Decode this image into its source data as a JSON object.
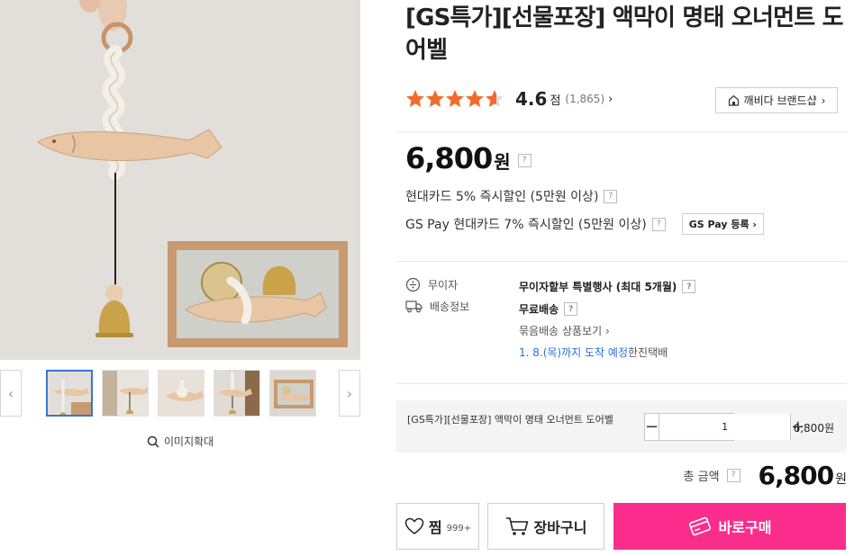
{
  "product": {
    "title": "[GS특가][선물포장] 액막이 명태 오너먼트 도어벨",
    "rating": {
      "stars": 4.6,
      "score": "4.6",
      "unit": "점",
      "count": "(1,865)",
      "arrow": "›"
    },
    "brand_shop": "깨비다 브랜드샵",
    "brand_arrow": "›",
    "price": {
      "amount": "6,800",
      "unit": "원",
      "help": "?"
    },
    "discounts": [
      {
        "text": "현대카드 5% 즉시할인 (5만원 이상)",
        "help": "?"
      },
      {
        "text": "GS Pay 현대카드 7% 즉시할인 (5만원 이상)",
        "help": "?",
        "button": "GS Pay 등록 ›"
      }
    ],
    "installment": {
      "label": "무이자",
      "value": "무이자할부 특별행사 (최대 5개월)",
      "help": "?"
    },
    "shipping": {
      "label": "배송정보",
      "value": "무료배송",
      "help": "?",
      "bundle_link": "묶음배송 상품보기 ›",
      "eta_highlight": "1. 8.(목)까지 도착 예정",
      "eta_carrier": " 한진택배"
    }
  },
  "gallery": {
    "prev": "‹",
    "next": "›",
    "thumbs": [
      "thumbnail-1",
      "thumbnail-2",
      "thumbnail-3",
      "thumbnail-4",
      "thumbnail-5"
    ],
    "active_index": 0,
    "zoom_label": "이미지확대"
  },
  "option": {
    "name": "[GS특가][선물포장] 액막이 명태 오너먼트 도어벨",
    "quantity": "1",
    "minus": "−",
    "plus": "+",
    "price": "6,800원"
  },
  "total": {
    "label": "총 금액",
    "help": "?",
    "amount": "6,800",
    "unit": "원"
  },
  "actions": {
    "wish_label": "찜",
    "wish_count": "999+",
    "cart_label": "장바구니",
    "buy_label": "바로구매"
  },
  "colors": {
    "buy": "#fb2d8c",
    "star": "#f26b2c",
    "link": "#2a6fd6",
    "active_thumb": "#3b73d8"
  }
}
